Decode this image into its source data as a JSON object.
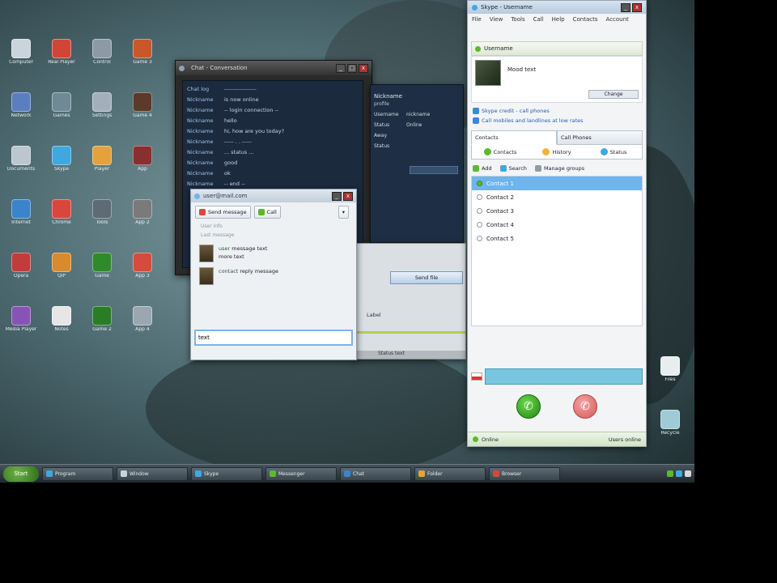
{
  "colors": {
    "desktop": "#4f6c73",
    "skype_selected": "#6fb4ea",
    "skype_status_green": "#5cb82e",
    "dial_input": "#78c6e0",
    "call_green": "#1f8a14",
    "call_red": "#d45959",
    "taskbar": "#20282e"
  },
  "desktop": {
    "icons": [
      {
        "label": "Computer",
        "color": "#c9d5da"
      },
      {
        "label": "Network",
        "color": "#5b7ec1"
      },
      {
        "label": "Documents",
        "color": "#bcc6cf"
      },
      {
        "label": "Internet",
        "color": "#3c84c9"
      },
      {
        "label": "Opera",
        "color": "#c23c3c"
      },
      {
        "label": "Media Player",
        "color": "#8754b5"
      },
      {
        "label": "Real Player",
        "color": "#d04636"
      },
      {
        "label": "Games",
        "color": "#6f8a96"
      },
      {
        "label": "Skype",
        "color": "#3fa8e0"
      },
      {
        "label": "Chrome",
        "color": "#d9473c"
      },
      {
        "label": "QIP",
        "color": "#d98a2c"
      },
      {
        "label": "Notes",
        "color": "#e6e6e6"
      },
      {
        "label": "Control",
        "color": "#8c9aa6"
      },
      {
        "label": "Settings",
        "color": "#a3b0bb"
      },
      {
        "label": "Player",
        "color": "#e3a23b"
      },
      {
        "label": "Tools",
        "color": "#5d6b74"
      },
      {
        "label": "Game",
        "color": "#2f8a2b"
      },
      {
        "label": "Game 2",
        "color": "#2a7d27"
      },
      {
        "label": "Game 3",
        "color": "#c9572a"
      },
      {
        "label": "Game 4",
        "color": "#5b3a2a"
      },
      {
        "label": "App",
        "color": "#8a2f2f"
      },
      {
        "label": "App 2",
        "color": "#7a7a7a"
      },
      {
        "label": "App 3",
        "color": "#d64b3d"
      },
      {
        "label": "App 4",
        "color": "#9aa7b0"
      }
    ],
    "right_icons": [
      {
        "label": "Files",
        "color": "#e8eef0"
      },
      {
        "label": "Recycle",
        "color": "#9fcbd6"
      }
    ]
  },
  "chat_window": {
    "title": "Chat - Conversation",
    "controls": {
      "minimize": "_",
      "maximize": "□",
      "close": "x"
    },
    "messages": [
      {
        "nick": "Chat log",
        "text": "-----------------"
      },
      {
        "nick": "Nickname",
        "text": "is now online"
      },
      {
        "nick": "Nickname",
        "text": "-- login connection --"
      },
      {
        "nick": "Nickname",
        "text": "hello"
      },
      {
        "nick": "Nickname",
        "text": "hi, how are you today?"
      },
      {
        "nick": "Nickname",
        "text": "----- . . -----"
      },
      {
        "nick": "Nickname",
        "text": "... status ..."
      },
      {
        "nick": "Nickname",
        "text": "good"
      },
      {
        "nick": "Nickname",
        "text": "ok"
      },
      {
        "nick": "Nickname",
        "text": "-- end --"
      }
    ]
  },
  "profile_panel": {
    "title": "Nickname",
    "subtitle": "profile",
    "rows": [
      {
        "k": "Username",
        "v": "nickname"
      },
      {
        "k": "Status",
        "v": "Online"
      },
      {
        "k": "Away",
        "v": ""
      },
      {
        "k": "Status",
        "v": ""
      }
    ]
  },
  "under_window": {
    "button_label": "Send file",
    "label": "Label",
    "strip_text": "Status text"
  },
  "im_window": {
    "title": "user@mail.com",
    "controls": {
      "minimize": "_",
      "close": "x"
    },
    "send_button": "Send message",
    "call_button": "Call",
    "options_icon": "▾",
    "meta1": "User info",
    "meta2": "Last message",
    "messages": [
      {
        "name": "user",
        "text": "message text",
        "line2": "more text"
      },
      {
        "name": "contact",
        "text": "reply message",
        "line2": ""
      }
    ],
    "input_value": "text"
  },
  "skype": {
    "title": "Skype - Username",
    "controls": {
      "minimize": "_",
      "close": "x"
    },
    "menu": [
      "File",
      "View",
      "Tools",
      "Call",
      "Help",
      "Contacts",
      "Account"
    ],
    "status_name": "Username",
    "mood_text": "Mood text",
    "profile_button": "Change",
    "promo_lines": [
      "Skype credit - call phones",
      "Call mobiles and landlines at low rates"
    ],
    "tabs": [
      "Contacts",
      "Call Phones"
    ],
    "subtabs": [
      "Contacts",
      "History",
      "Status"
    ],
    "actions": [
      "Add",
      "Search",
      "Manage groups"
    ],
    "contacts": [
      {
        "name": "Contact 1",
        "selected": true
      },
      {
        "name": "Contact 2",
        "selected": false
      },
      {
        "name": "Contact 3",
        "selected": false
      },
      {
        "name": "Contact 4",
        "selected": false
      },
      {
        "name": "Contact 5",
        "selected": false
      }
    ],
    "dial_value": "",
    "call_icon": "✆",
    "hangup_icon": "✆",
    "status_bar_left": "Online",
    "status_bar_right": "Users online"
  },
  "taskbar": {
    "start_label": "Start",
    "buttons": [
      {
        "label": "Program",
        "color": "#3fa8e0"
      },
      {
        "label": "Window",
        "color": "#c9d5da"
      },
      {
        "label": "Skype",
        "color": "#3fa8e0"
      },
      {
        "label": "Messenger",
        "color": "#5cb82e"
      },
      {
        "label": "Chat",
        "color": "#3c84c9"
      },
      {
        "label": "Folder",
        "color": "#e3a23b"
      },
      {
        "label": "Browser",
        "color": "#d9473c"
      }
    ]
  }
}
